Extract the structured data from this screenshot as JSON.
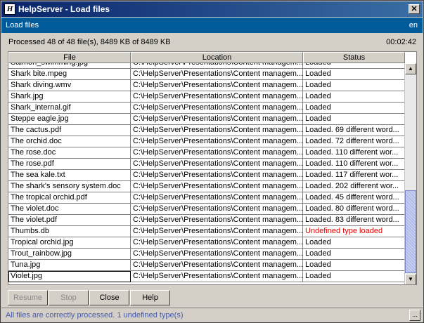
{
  "window": {
    "title": "HelpServer - Load files",
    "icon": "helpserver-app-icon",
    "close_label": "✕"
  },
  "header": {
    "title": "Load files",
    "language": "en"
  },
  "progress": {
    "summary": "Processed 48 of 48 file(s), 8489 KB of 8489 KB",
    "elapsed": "00:02:42"
  },
  "table": {
    "columns": [
      "File",
      "Location",
      "Status"
    ],
    "rows": [
      {
        "file": "Salmon_swimming.jpg",
        "location": "C:\\HelpServer\\Presentations\\Content managem...",
        "status": "Loaded"
      },
      {
        "file": "Shark bite.mpeg",
        "location": "C:\\HelpServer\\Presentations\\Content managem...",
        "status": "Loaded"
      },
      {
        "file": "Shark diving.wmv",
        "location": "C:\\HelpServer\\Presentations\\Content managem...",
        "status": "Loaded"
      },
      {
        "file": "Shark.jpg",
        "location": "C:\\HelpServer\\Presentations\\Content managem...",
        "status": "Loaded"
      },
      {
        "file": "Shark_internal.gif",
        "location": "C:\\HelpServer\\Presentations\\Content managem...",
        "status": "Loaded"
      },
      {
        "file": "Steppe eagle.jpg",
        "location": "C:\\HelpServer\\Presentations\\Content managem...",
        "status": "Loaded"
      },
      {
        "file": "The cactus.pdf",
        "location": "C:\\HelpServer\\Presentations\\Content managem...",
        "status": "Loaded. 69 different word..."
      },
      {
        "file": "The orchid.doc",
        "location": "C:\\HelpServer\\Presentations\\Content managem...",
        "status": "Loaded. 72 different word..."
      },
      {
        "file": "The rose.doc",
        "location": "C:\\HelpServer\\Presentations\\Content managem...",
        "status": "Loaded. 110 different wor..."
      },
      {
        "file": "The rose.pdf",
        "location": "C:\\HelpServer\\Presentations\\Content managem...",
        "status": "Loaded. 110 different wor..."
      },
      {
        "file": "The sea kale.txt",
        "location": "C:\\HelpServer\\Presentations\\Content managem...",
        "status": "Loaded. 117 different wor..."
      },
      {
        "file": "The shark's sensory system.doc",
        "location": "C:\\HelpServer\\Presentations\\Content managem...",
        "status": "Loaded. 202 different wor..."
      },
      {
        "file": "The tropical orchid.pdf",
        "location": "C:\\HelpServer\\Presentations\\Content managem...",
        "status": "Loaded. 45 different word..."
      },
      {
        "file": "The violet.doc",
        "location": "C:\\HelpServer\\Presentations\\Content managem...",
        "status": "Loaded. 80 different word..."
      },
      {
        "file": "The violet.pdf",
        "location": "C:\\HelpServer\\Presentations\\Content managem...",
        "status": "Loaded. 83 different word..."
      },
      {
        "file": "Thumbs.db",
        "location": "C:\\HelpServer\\Presentations\\Content managem...",
        "status": "Undefined type loaded",
        "error": true
      },
      {
        "file": "Tropical orchid.jpg",
        "location": "C:\\HelpServer\\Presentations\\Content managem...",
        "status": "Loaded"
      },
      {
        "file": "Trout_rainbow.jpg",
        "location": "C:\\HelpServer\\Presentations\\Content managem...",
        "status": "Loaded"
      },
      {
        "file": "Tuna.jpg",
        "location": "C:\\HelpServer\\Presentations\\Content managem...",
        "status": "Loaded"
      },
      {
        "file": "Violet.jpg",
        "location": "C:\\HelpServer\\Presentations\\Content managem...",
        "status": "Loaded",
        "selected": true
      }
    ],
    "scroll_position": 0.78
  },
  "buttons": {
    "resume": "Resume",
    "stop": "Stop",
    "close": "Close",
    "help": "Help"
  },
  "status_bar": {
    "message": "All files are correctly processed. 1 undefined type(s)",
    "more_label": "..."
  },
  "colors": {
    "title_gradient_start": "#0a246a",
    "header_bg": "#005b9a",
    "error_text": "#e00000",
    "status_text": "#4a5ba8"
  }
}
